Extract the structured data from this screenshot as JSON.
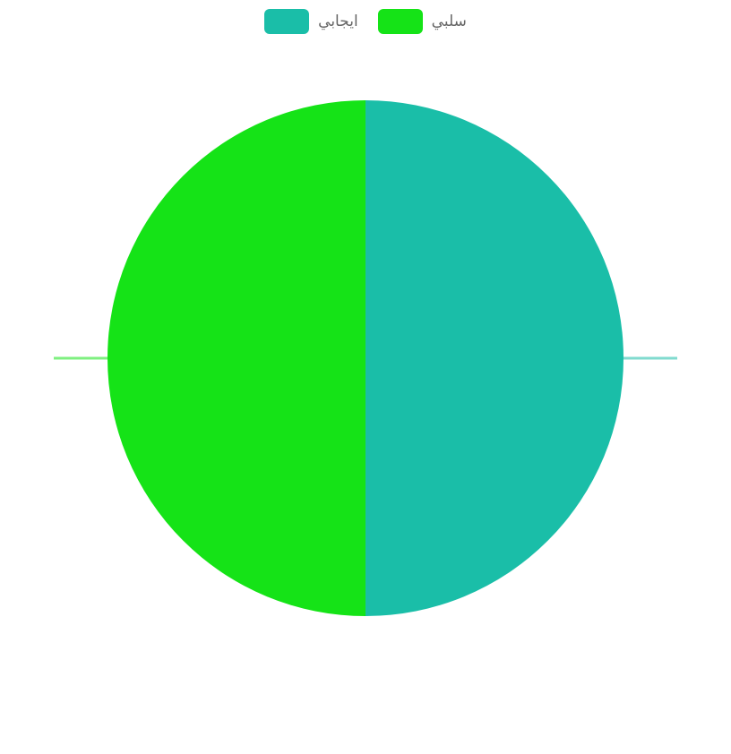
{
  "chart_data": {
    "type": "pie",
    "categories": [
      "ايجابي",
      "سلبي"
    ],
    "values": [
      50,
      50
    ],
    "colors": [
      "#1abea8",
      "#15e317"
    ],
    "title": "",
    "legend_position": "top-center"
  }
}
